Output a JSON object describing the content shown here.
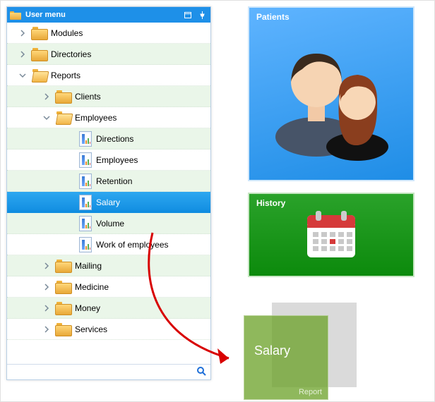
{
  "panel": {
    "title": "User menu"
  },
  "tree": {
    "items": [
      {
        "label": "Modules",
        "icon": "folder",
        "depth": 0,
        "expander": "right",
        "alt": false
      },
      {
        "label": "Directories",
        "icon": "folder",
        "depth": 0,
        "expander": "right",
        "alt": true
      },
      {
        "label": "Reports",
        "icon": "folder-open",
        "depth": 0,
        "expander": "down",
        "alt": false
      },
      {
        "label": "Clients",
        "icon": "folder",
        "depth": 1,
        "expander": "right",
        "alt": true
      },
      {
        "label": "Employees",
        "icon": "folder-open",
        "depth": 1,
        "expander": "down",
        "alt": false
      },
      {
        "label": "Directions",
        "icon": "report",
        "depth": 2,
        "expander": "none",
        "alt": true
      },
      {
        "label": "Employees",
        "icon": "report",
        "depth": 2,
        "expander": "none",
        "alt": false
      },
      {
        "label": "Retention",
        "icon": "report",
        "depth": 2,
        "expander": "none",
        "alt": true
      },
      {
        "label": "Salary",
        "icon": "report",
        "depth": 2,
        "expander": "none",
        "alt": false,
        "selected": true
      },
      {
        "label": "Volume",
        "icon": "report",
        "depth": 2,
        "expander": "none",
        "alt": true
      },
      {
        "label": "Work of employees",
        "icon": "report",
        "depth": 2,
        "expander": "none",
        "alt": false
      },
      {
        "label": "Mailing",
        "icon": "folder",
        "depth": 1,
        "expander": "right",
        "alt": true
      },
      {
        "label": "Medicine",
        "icon": "folder",
        "depth": 1,
        "expander": "right",
        "alt": false
      },
      {
        "label": "Money",
        "icon": "folder",
        "depth": 1,
        "expander": "right",
        "alt": true
      },
      {
        "label": "Services",
        "icon": "folder",
        "depth": 1,
        "expander": "right",
        "alt": false
      }
    ]
  },
  "tiles": {
    "patients": "Patients",
    "history": "History"
  },
  "drag": {
    "title": "Salary",
    "subtitle": "Report"
  }
}
